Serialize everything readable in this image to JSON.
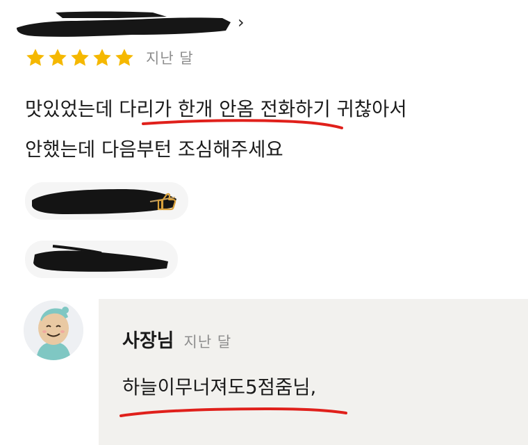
{
  "review": {
    "rating": 5,
    "date": "지난 달",
    "text_line_1": "맛있었는데 다리가 한개 안옴 전화하기 귀찮아서",
    "text_line_2": "안했는데 다음부턴 조심해주세요",
    "star_color": "#f5b800",
    "underline_color": "#e0201b"
  },
  "owner_reply": {
    "name": "사장님",
    "date": "지난 달",
    "text": "하늘이무너져도5점줌님,"
  }
}
